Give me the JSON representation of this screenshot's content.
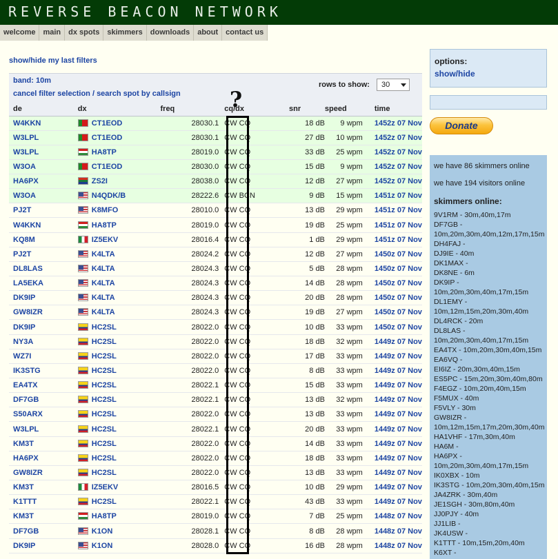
{
  "header": {
    "title": "REVERSE BEACON NETWORK"
  },
  "nav": [
    "welcome",
    "main",
    "dx spots",
    "skimmers",
    "downloads",
    "about",
    "contact us"
  ],
  "filters": {
    "showhide_label": "show/hide my last filters",
    "band_label": "band: 10m",
    "cancel_label": "cancel filter selection",
    "separator": " / ",
    "search_label": "search spot by callsign",
    "rows_label": "rows to show:",
    "rows_value": "30"
  },
  "table": {
    "columns": [
      "de",
      "dx",
      "freq",
      "cq/dx",
      "snr",
      "speed",
      "time"
    ],
    "rows": [
      {
        "de": "W4KKN",
        "flag": "pt",
        "dx": "CT1EOD",
        "freq": "28030.1",
        "cq": "CW CQ",
        "snr": "18 dB",
        "speed": "9 wpm",
        "time": "1452z 07 Nov",
        "new": true
      },
      {
        "de": "W3LPL",
        "flag": "pt",
        "dx": "CT1EOD",
        "freq": "28030.1",
        "cq": "CW CQ",
        "snr": "27 dB",
        "speed": "10 wpm",
        "time": "1452z 07 Nov",
        "new": true
      },
      {
        "de": "W3LPL",
        "flag": "hu",
        "dx": "HA8TP",
        "freq": "28019.0",
        "cq": "CW CQ",
        "snr": "33 dB",
        "speed": "25 wpm",
        "time": "1452z 07 Nov",
        "new": true
      },
      {
        "de": "W3OA",
        "flag": "pt",
        "dx": "CT1EOD",
        "freq": "28030.0",
        "cq": "CW CQ",
        "snr": "15 dB",
        "speed": "9 wpm",
        "time": "1452z 07 Nov",
        "new": true
      },
      {
        "de": "HA6PX",
        "flag": "za",
        "dx": "ZS2I",
        "freq": "28038.0",
        "cq": "CW CQ",
        "snr": "12 dB",
        "speed": "27 wpm",
        "time": "1452z 07 Nov",
        "new": true
      },
      {
        "de": "W3OA",
        "flag": "us",
        "dx": "N4QDK/B",
        "freq": "28222.6",
        "cq": "CW BCN",
        "snr": "9 dB",
        "speed": "15 wpm",
        "time": "1451z 07 Nov",
        "new": true
      },
      {
        "de": "PJ2T",
        "flag": "us",
        "dx": "K8MFO",
        "freq": "28010.0",
        "cq": "CW CQ",
        "snr": "13 dB",
        "speed": "29 wpm",
        "time": "1451z 07 Nov",
        "new": false
      },
      {
        "de": "W4KKN",
        "flag": "hu",
        "dx": "HA8TP",
        "freq": "28019.0",
        "cq": "CW CQ",
        "snr": "19 dB",
        "speed": "25 wpm",
        "time": "1451z 07 Nov",
        "new": false
      },
      {
        "de": "KQ8M",
        "flag": "it",
        "dx": "IZ5EKV",
        "freq": "28016.4",
        "cq": "CW CQ",
        "snr": "1 dB",
        "speed": "29 wpm",
        "time": "1451z 07 Nov",
        "new": false
      },
      {
        "de": "PJ2T",
        "flag": "us",
        "dx": "K4LTA",
        "freq": "28024.2",
        "cq": "CW CQ",
        "snr": "12 dB",
        "speed": "27 wpm",
        "time": "1450z 07 Nov",
        "new": false
      },
      {
        "de": "DL8LAS",
        "flag": "us",
        "dx": "K4LTA",
        "freq": "28024.3",
        "cq": "CW CQ",
        "snr": "5 dB",
        "speed": "28 wpm",
        "time": "1450z 07 Nov",
        "new": false
      },
      {
        "de": "LA5EKA",
        "flag": "us",
        "dx": "K4LTA",
        "freq": "28024.3",
        "cq": "CW CQ",
        "snr": "14 dB",
        "speed": "28 wpm",
        "time": "1450z 07 Nov",
        "new": false
      },
      {
        "de": "DK9IP",
        "flag": "us",
        "dx": "K4LTA",
        "freq": "28024.3",
        "cq": "CW CQ",
        "snr": "20 dB",
        "speed": "28 wpm",
        "time": "1450z 07 Nov",
        "new": false
      },
      {
        "de": "GW8IZR",
        "flag": "us",
        "dx": "K4LTA",
        "freq": "28024.3",
        "cq": "CW CQ",
        "snr": "19 dB",
        "speed": "27 wpm",
        "time": "1450z 07 Nov",
        "new": false
      },
      {
        "de": "DK9IP",
        "flag": "ec",
        "dx": "HC2SL",
        "freq": "28022.0",
        "cq": "CW CQ",
        "snr": "10 dB",
        "speed": "33 wpm",
        "time": "1450z 07 Nov",
        "new": false
      },
      {
        "de": "NY3A",
        "flag": "ec",
        "dx": "HC2SL",
        "freq": "28022.0",
        "cq": "CW CQ",
        "snr": "18 dB",
        "speed": "32 wpm",
        "time": "1449z 07 Nov",
        "new": false
      },
      {
        "de": "WZ7I",
        "flag": "ec",
        "dx": "HC2SL",
        "freq": "28022.0",
        "cq": "CW CQ",
        "snr": "17 dB",
        "speed": "33 wpm",
        "time": "1449z 07 Nov",
        "new": false
      },
      {
        "de": "IK3STG",
        "flag": "ec",
        "dx": "HC2SL",
        "freq": "28022.0",
        "cq": "CW CQ",
        "snr": "8 dB",
        "speed": "33 wpm",
        "time": "1449z 07 Nov",
        "new": false
      },
      {
        "de": "EA4TX",
        "flag": "ec",
        "dx": "HC2SL",
        "freq": "28022.1",
        "cq": "CW CQ",
        "snr": "15 dB",
        "speed": "33 wpm",
        "time": "1449z 07 Nov",
        "new": false
      },
      {
        "de": "DF7GB",
        "flag": "ec",
        "dx": "HC2SL",
        "freq": "28022.1",
        "cq": "CW CQ",
        "snr": "13 dB",
        "speed": "32 wpm",
        "time": "1449z 07 Nov",
        "new": false
      },
      {
        "de": "S50ARX",
        "flag": "ec",
        "dx": "HC2SL",
        "freq": "28022.0",
        "cq": "CW CQ",
        "snr": "13 dB",
        "speed": "33 wpm",
        "time": "1449z 07 Nov",
        "new": false
      },
      {
        "de": "W3LPL",
        "flag": "ec",
        "dx": "HC2SL",
        "freq": "28022.1",
        "cq": "CW CQ",
        "snr": "20 dB",
        "speed": "33 wpm",
        "time": "1449z 07 Nov",
        "new": false
      },
      {
        "de": "KM3T",
        "flag": "ec",
        "dx": "HC2SL",
        "freq": "28022.0",
        "cq": "CW CQ",
        "snr": "14 dB",
        "speed": "33 wpm",
        "time": "1449z 07 Nov",
        "new": false
      },
      {
        "de": "HA6PX",
        "flag": "ec",
        "dx": "HC2SL",
        "freq": "28022.0",
        "cq": "CW CQ",
        "snr": "18 dB",
        "speed": "33 wpm",
        "time": "1449z 07 Nov",
        "new": false
      },
      {
        "de": "GW8IZR",
        "flag": "ec",
        "dx": "HC2SL",
        "freq": "28022.0",
        "cq": "CW CQ",
        "snr": "13 dB",
        "speed": "33 wpm",
        "time": "1449z 07 Nov",
        "new": false
      },
      {
        "de": "KM3T",
        "flag": "it",
        "dx": "IZ5EKV",
        "freq": "28016.5",
        "cq": "CW CQ",
        "snr": "10 dB",
        "speed": "29 wpm",
        "time": "1449z 07 Nov",
        "new": false
      },
      {
        "de": "K1TTT",
        "flag": "ec",
        "dx": "HC2SL",
        "freq": "28022.1",
        "cq": "CW CQ",
        "snr": "43 dB",
        "speed": "33 wpm",
        "time": "1449z 07 Nov",
        "new": false
      },
      {
        "de": "KM3T",
        "flag": "hu",
        "dx": "HA8TP",
        "freq": "28019.0",
        "cq": "CW CQ",
        "snr": "7 dB",
        "speed": "25 wpm",
        "time": "1448z 07 Nov",
        "new": false
      },
      {
        "de": "DF7GB",
        "flag": "us",
        "dx": "K1ON",
        "freq": "28028.1",
        "cq": "CW CQ",
        "snr": "8 dB",
        "speed": "28 wpm",
        "time": "1448z 07 Nov",
        "new": false
      },
      {
        "de": "DK9IP",
        "flag": "us",
        "dx": "K1ON",
        "freq": "28028.0",
        "cq": "CW CQ",
        "snr": "16 dB",
        "speed": "28 wpm",
        "time": "1448z 07 Nov",
        "new": false
      }
    ]
  },
  "annotation": {
    "question_mark": "?"
  },
  "sidebar": {
    "options_title": "options:",
    "options_showhide": "show/hide",
    "donate_label": "Donate",
    "skimmers_count_text": "we have 86 skimmers online",
    "visitors_count_text": "we have 194 visitors online",
    "skimmers_title": "skimmers online:",
    "skimmer_lines": [
      "9V1RM - 30m,40m,17m",
      "DF7GB -",
      "10m,20m,30m,40m,12m,17m,15m",
      "DH4FAJ -",
      "DJ9IE - 40m",
      "DK1MAX -",
      "DK8NE - 6m",
      "DK9IP -",
      "10m,20m,30m,40m,17m,15m",
      "DL1EMY -",
      "10m,12m,15m,20m,30m,40m",
      "DL4RCK - 20m",
      "DL8LAS -",
      "10m,20m,30m,40m,17m,15m",
      "EA4TX - 10m,20m,30m,40m,15m",
      "EA6VQ -",
      "EI6IZ - 20m,30m,40m,15m",
      "ES5PC - 15m,20m,30m,40m,80m",
      "F4EGZ - 10m,20m,40m,15m",
      "F5MUX - 40m",
      "F5VLY - 30m",
      "GW8IZR -",
      "10m,12m,15m,17m,20m,30m,40m",
      "HA1VHF - 17m,30m,40m",
      "HA6M -",
      "HA6PX -",
      "10m,20m,30m,40m,17m,15m",
      "IK0XBX - 10m",
      "IK3STG - 10m,20m,30m,40m,15m",
      "JA4ZRK - 30m,40m",
      "JE1SGH - 30m,80m,40m",
      "JJ0PJY - 40m",
      "JJ1LIB -",
      "JK4USW -",
      "K1TTT - 10m,15m,20m,40m",
      "K6XT -"
    ]
  },
  "colors": {
    "banner": "#033b06",
    "link": "#1d45a3",
    "new_row": "#e7ffe1",
    "side_panel": "#a9cae3"
  }
}
